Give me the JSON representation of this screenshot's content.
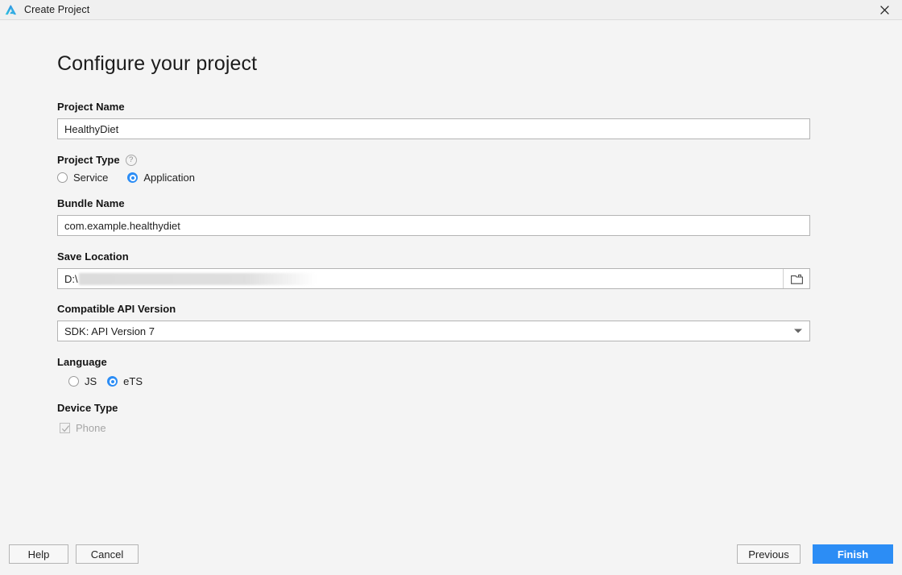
{
  "window": {
    "title": "Create Project",
    "app_icon": "harmony-logo-icon",
    "close_label": "✕",
    "accent_color": "#2c8df5"
  },
  "page": {
    "heading": "Configure your project"
  },
  "form": {
    "project_name": {
      "label": "Project Name",
      "value": "HealthyDiet",
      "placeholder": ""
    },
    "project_type": {
      "label": "Project Type",
      "help_glyph": "?",
      "options": [
        {
          "label": "Service",
          "selected": false
        },
        {
          "label": "Application",
          "selected": true
        }
      ],
      "selected": "Application"
    },
    "bundle_name": {
      "label": "Bundle Name",
      "value": "com.example.healthydiet",
      "placeholder": ""
    },
    "save_location": {
      "label": "Save Location",
      "value": "D:\\",
      "redacted": true,
      "browse_icon": "folder-icon"
    },
    "api_version": {
      "label": "Compatible API Version",
      "value": "SDK: API Version 7",
      "options": [
        "SDK: API Version 7"
      ]
    },
    "language": {
      "label": "Language",
      "options": [
        {
          "label": "JS",
          "selected": false
        },
        {
          "label": "eTS",
          "selected": true
        }
      ],
      "selected": "eTS"
    },
    "device_type": {
      "label": "Device Type",
      "options": [
        {
          "label": "Phone",
          "checked": true,
          "disabled": true
        }
      ]
    }
  },
  "footer": {
    "help": "Help",
    "cancel": "Cancel",
    "previous": "Previous",
    "finish": "Finish"
  }
}
